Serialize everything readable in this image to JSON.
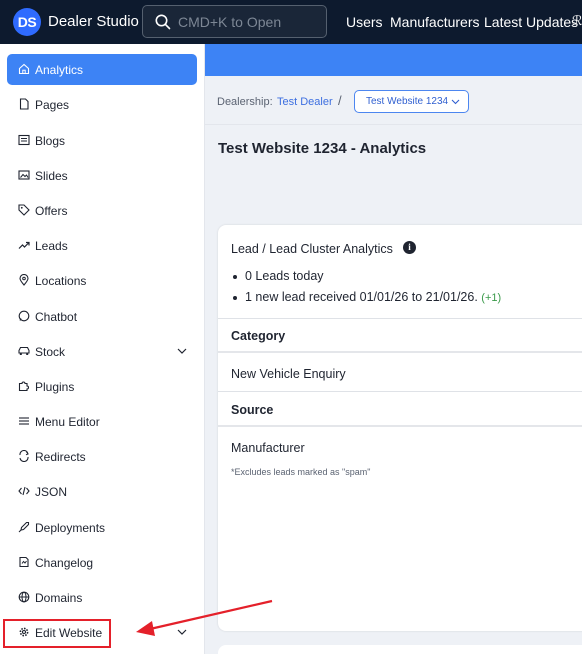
{
  "app": {
    "logo_text": "DS",
    "title": "Dealer Studio"
  },
  "search": {
    "placeholder": "CMD+K to Open"
  },
  "topnav": [
    "Users",
    "Manufacturers",
    "Latest Updates",
    "ℛ"
  ],
  "sidebar": {
    "items": [
      {
        "label": "Analytics",
        "icon": "home-icon",
        "active": true
      },
      {
        "label": "Pages",
        "icon": "page-icon"
      },
      {
        "label": "Blogs",
        "icon": "blog-icon"
      },
      {
        "label": "Slides",
        "icon": "slides-icon"
      },
      {
        "label": "Offers",
        "icon": "tag-icon"
      },
      {
        "label": "Leads",
        "icon": "trend-icon"
      },
      {
        "label": "Locations",
        "icon": "location-pin-icon"
      },
      {
        "label": "Chatbot",
        "icon": "chat-icon"
      },
      {
        "label": "Stock",
        "icon": "car-icon",
        "expandable": true
      },
      {
        "label": "Plugins",
        "icon": "puzzle-icon"
      },
      {
        "label": "Menu Editor",
        "icon": "menu-icon"
      },
      {
        "label": "Redirects",
        "icon": "redirect-icon"
      },
      {
        "label": "JSON",
        "icon": "code-icon"
      },
      {
        "label": "Deployments",
        "icon": "rocket-icon"
      },
      {
        "label": "Changelog",
        "icon": "changelog-icon"
      },
      {
        "label": "Domains",
        "icon": "globe-icon"
      },
      {
        "label": "Edit Website",
        "icon": "gear-icon",
        "expandable": true
      }
    ]
  },
  "breadcrumb": {
    "label": "Dealership:",
    "dealer": "Test Dealer",
    "separator": "/",
    "website": "Test Website 1234"
  },
  "page_title": "Test Website 1234 - Analytics",
  "lead_card": {
    "title": "Lead / Lead Cluster Analytics",
    "info_icon": "i",
    "bullets": {
      "today": "0 Leads today",
      "range": "1 new lead received 01/01/26 to 21/01/26.",
      "delta": "(+1)"
    },
    "category_heading": "Category",
    "category_value": "New Vehicle Enquiry",
    "source_heading": "Source",
    "source_value": "Manufacturer",
    "footnote": "*Excludes leads marked as \"spam\""
  },
  "colors": {
    "topbar": "#0d1a2e",
    "accent": "#3d83f5",
    "highlight": "#e4202a"
  }
}
